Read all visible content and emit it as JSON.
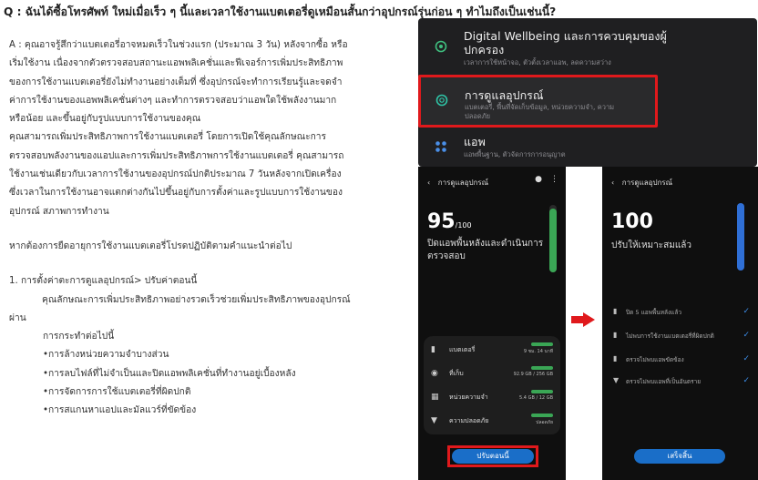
{
  "question": "Q : ฉันได้ซื้อโทรศัพท์ ใหม่เมื่อเร็ว ๆ นี้และเวลาใช้งานแบตเตอรี่ดูเหมือนสั้นกว่าอุปกรณ์รุ่นก่อน ๆ ทำไมถึงเป็นเช่นนี้?",
  "answer_lines": [
    "A : คุณอาจรู้สึกว่าแบตเตอรี่อาจหมดเร็วในช่วงแรก (ประมาณ 3 วัน) หลังจากซื้อ หรือ",
    "เริ่มใช้งาน เนื่องจากตัวตรวจสอบสถานะแอพพลิเคชั่นและฟีเจอร์การเพิ่มประสิทธิภาพ",
    "ของการใช้งานแบตเตอรี่ยังไม่ทำงานอย่างเต็มที่ ซึ่งอุปกรณ์จะทำการเรียนรู้และจดจำ",
    "ค่าการใช้งานของแอพพลิเคชั่นต่างๆ และทำการตรวจสอบว่าแอพใดใช้พลังงานมาก",
    "หรือน้อย และขึ้นอยู่กับรูปแบบการใช้งานของคุณ",
    "คุณสามารถเพิ่มประสิทธิภาพการใช้งานแบตเตอรี่ โดยการเปิดใช้คุณลักษณะการ",
    "ตรวจสอบพลังงานของแอปและการเพิ่มประสิทธิภาพการใช้งานแบตเตอรี่ คุณสามารถ",
    "ใช้งานเช่นเดียวกับเวลาการใช้งานของอุปกรณ์ปกติประมาณ 7 วันหลังจากเปิดเครื่อง",
    "ซึ่งเวลาในการใช้งานอาจแตกต่างกันไปขึ้นอยู่กับการตั้งค่าและรูปแบบการใช้งานของ",
    "อุปกรณ์  สภาพการทำงาน"
  ],
  "followup": "หากต้องการยืดอายุการใช้งานแบตเตอรี่โปรดปฏิบัติตามคำแนะนำต่อไป",
  "step1": "1. การตั้งค่าตะการดูแลอุปกรณ์> ปรับค่าตอนนี้",
  "step1_desc_a": "คุณลักษณะการเพิ่มประสิทธิภาพอย่างรวดเร็วช่วยเพิ่มประสิทธิภาพของอุปกรณ์",
  "step1_desc_b": "ผ่าน",
  "process_title": "การกระทำต่อไปนี้",
  "bullets": [
    "•การล้างหน่วยความจำบางส่วน",
    "•การลบไฟล์ที่ไม่จำเป็นและปิดแอพพลิเคชั่นที่ทำงานอยู่เบื้องหลัง",
    "•การจัดการการใช้แบตเตอรี่ที่ผิดปกติ",
    "•การสแกนหาแอปและมัลแวร์ที่ขัดข้อง"
  ],
  "menu": {
    "items": [
      {
        "title": "Digital Wellbeing และการควบคุมของผู้",
        "title2": "ปกครอง",
        "sub": "เวลาการใช้หน้าจอ, ตัวตั้งเวลาแอพ, ลดความสว่าง"
      },
      {
        "title": "การดูแลอุปกรณ์",
        "sub": "แบตเตอรี่, พื้นที่จัดเก็บข้อมูล, หน่วยความจำ, ความ",
        "sub2": "ปลอดภัย"
      },
      {
        "title": "แอพ",
        "sub": "แอพพื้นฐาน, ตัวจัดการการอนุญาต"
      }
    ]
  },
  "phone1": {
    "header": "การดูแลอุปกรณ์",
    "score": "95",
    "score_suffix": "/100",
    "message_line1": "ปิดแอพพื้นหลังและดำเนินการ",
    "message_line2": "ตรวจสอบ",
    "score_fill": 0.95,
    "rows": [
      {
        "label": "แบตเตอรี่",
        "value": "9 ชม. 14 นาที"
      },
      {
        "label": "ที่เก็บ",
        "value": "92.9 GB / 256 GB"
      },
      {
        "label": "หน่วยความจำ",
        "value": "5.4 GB / 12 GB"
      },
      {
        "label": "ความปลอดภัย",
        "value": "ปลอดภัย"
      }
    ],
    "button": "ปรับตอนนี้"
  },
  "phone2": {
    "header": "การดูแลอุปกรณ์",
    "score": "100",
    "message": "ปรับให้เหมาะสมแล้ว",
    "score_fill": 1.0,
    "checks": [
      "ปิด 5 แอพพื้นหลังแล้ว",
      "ไม่พบการใช้งานแบตเตอรี่ที่ผิดปกติ",
      "ตรวจไม่พบแอพขัดข้อง",
      "ตรวจไม่พบแอพที่เป็นอันตราย"
    ],
    "button": "เสร็จสิ้น"
  },
  "colors": {
    "highlight": "#e0191c",
    "green": "#3aa655",
    "blue": "#2f6fd6",
    "button": "#1a6ec8"
  }
}
